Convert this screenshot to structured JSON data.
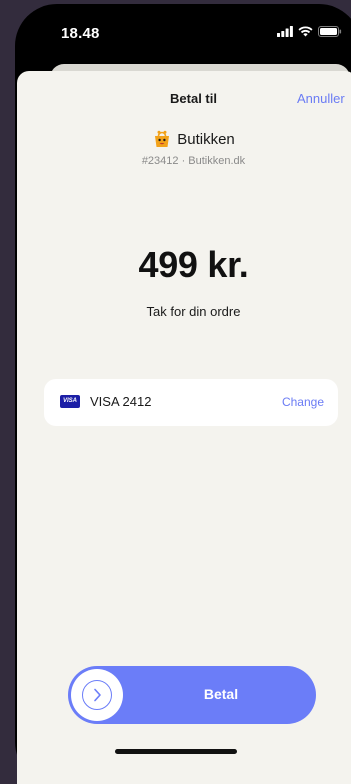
{
  "status_bar": {
    "time": "18.48",
    "icons": [
      "cellular-signal-icon",
      "wifi-icon",
      "battery-icon"
    ]
  },
  "header": {
    "title": "Betal til",
    "cancel_label": "Annuller"
  },
  "merchant": {
    "logo_icon": "merchant-logo-icon",
    "name": "Butikken",
    "meta": "#23412 · Butikken.dk"
  },
  "payment": {
    "amount": "499 kr.",
    "message": "Tak for din ordre"
  },
  "card": {
    "brand_badge": "VISA",
    "label": "VISA 2412",
    "change_label": "Change"
  },
  "pay_button": {
    "label": "Betal",
    "icon": "chevron-right-icon"
  },
  "colors": {
    "background": "#332c3d",
    "sheet": "#f4f3ee",
    "accent": "#6b7df8",
    "link": "#6b7cf4",
    "visa_blue": "#1c1fa6"
  }
}
